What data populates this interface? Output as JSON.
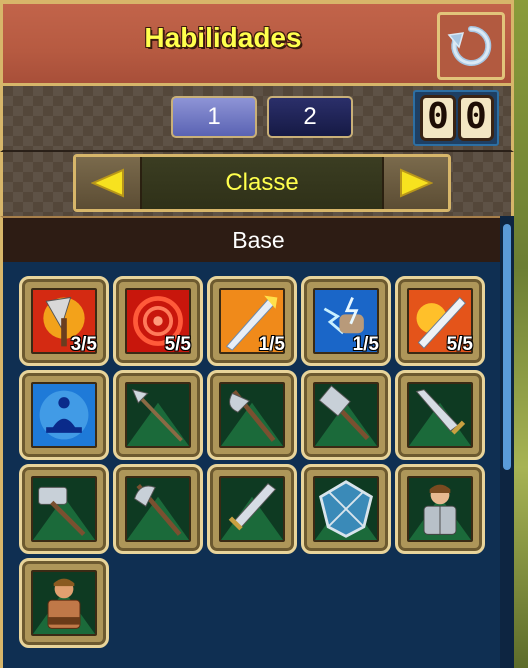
{
  "header": {
    "title": "Habilidades",
    "refresh_icon": "refresh-icon"
  },
  "pages": [
    {
      "label": "1"
    },
    {
      "label": "2"
    }
  ],
  "skill_points": {
    "digits": [
      "0",
      "0"
    ]
  },
  "class_selector": {
    "label": "Classe",
    "left_icon": "arrow-left-icon",
    "right_icon": "arrow-right-icon"
  },
  "section": {
    "title": "Base"
  },
  "colors": {
    "title": "#ffff4d",
    "header_bg": "#b65a41",
    "grid_bg": "#0f2f52",
    "frame_gold": "#d7b66a"
  },
  "skills": [
    {
      "icon": "axe-fire-icon",
      "level": "3/5"
    },
    {
      "icon": "red-swirl-icon",
      "level": "5/5"
    },
    {
      "icon": "sword-strike-icon",
      "level": "1/5"
    },
    {
      "icon": "lightning-fist-icon",
      "level": "1/5"
    },
    {
      "icon": "flame-blade-icon",
      "level": "5/5"
    },
    {
      "icon": "meditation-icon",
      "level": ""
    },
    {
      "icon": "spear-icon",
      "level": ""
    },
    {
      "icon": "battle-axe-icon",
      "level": ""
    },
    {
      "icon": "warhammer-icon",
      "level": ""
    },
    {
      "icon": "sword-icon",
      "level": ""
    },
    {
      "icon": "hammer-icon",
      "level": ""
    },
    {
      "icon": "double-axe-icon",
      "level": ""
    },
    {
      "icon": "broadsword-icon",
      "level": ""
    },
    {
      "icon": "shield-icon",
      "level": ""
    },
    {
      "icon": "armored-knight-icon",
      "level": ""
    },
    {
      "icon": "barbarian-icon",
      "level": ""
    }
  ]
}
